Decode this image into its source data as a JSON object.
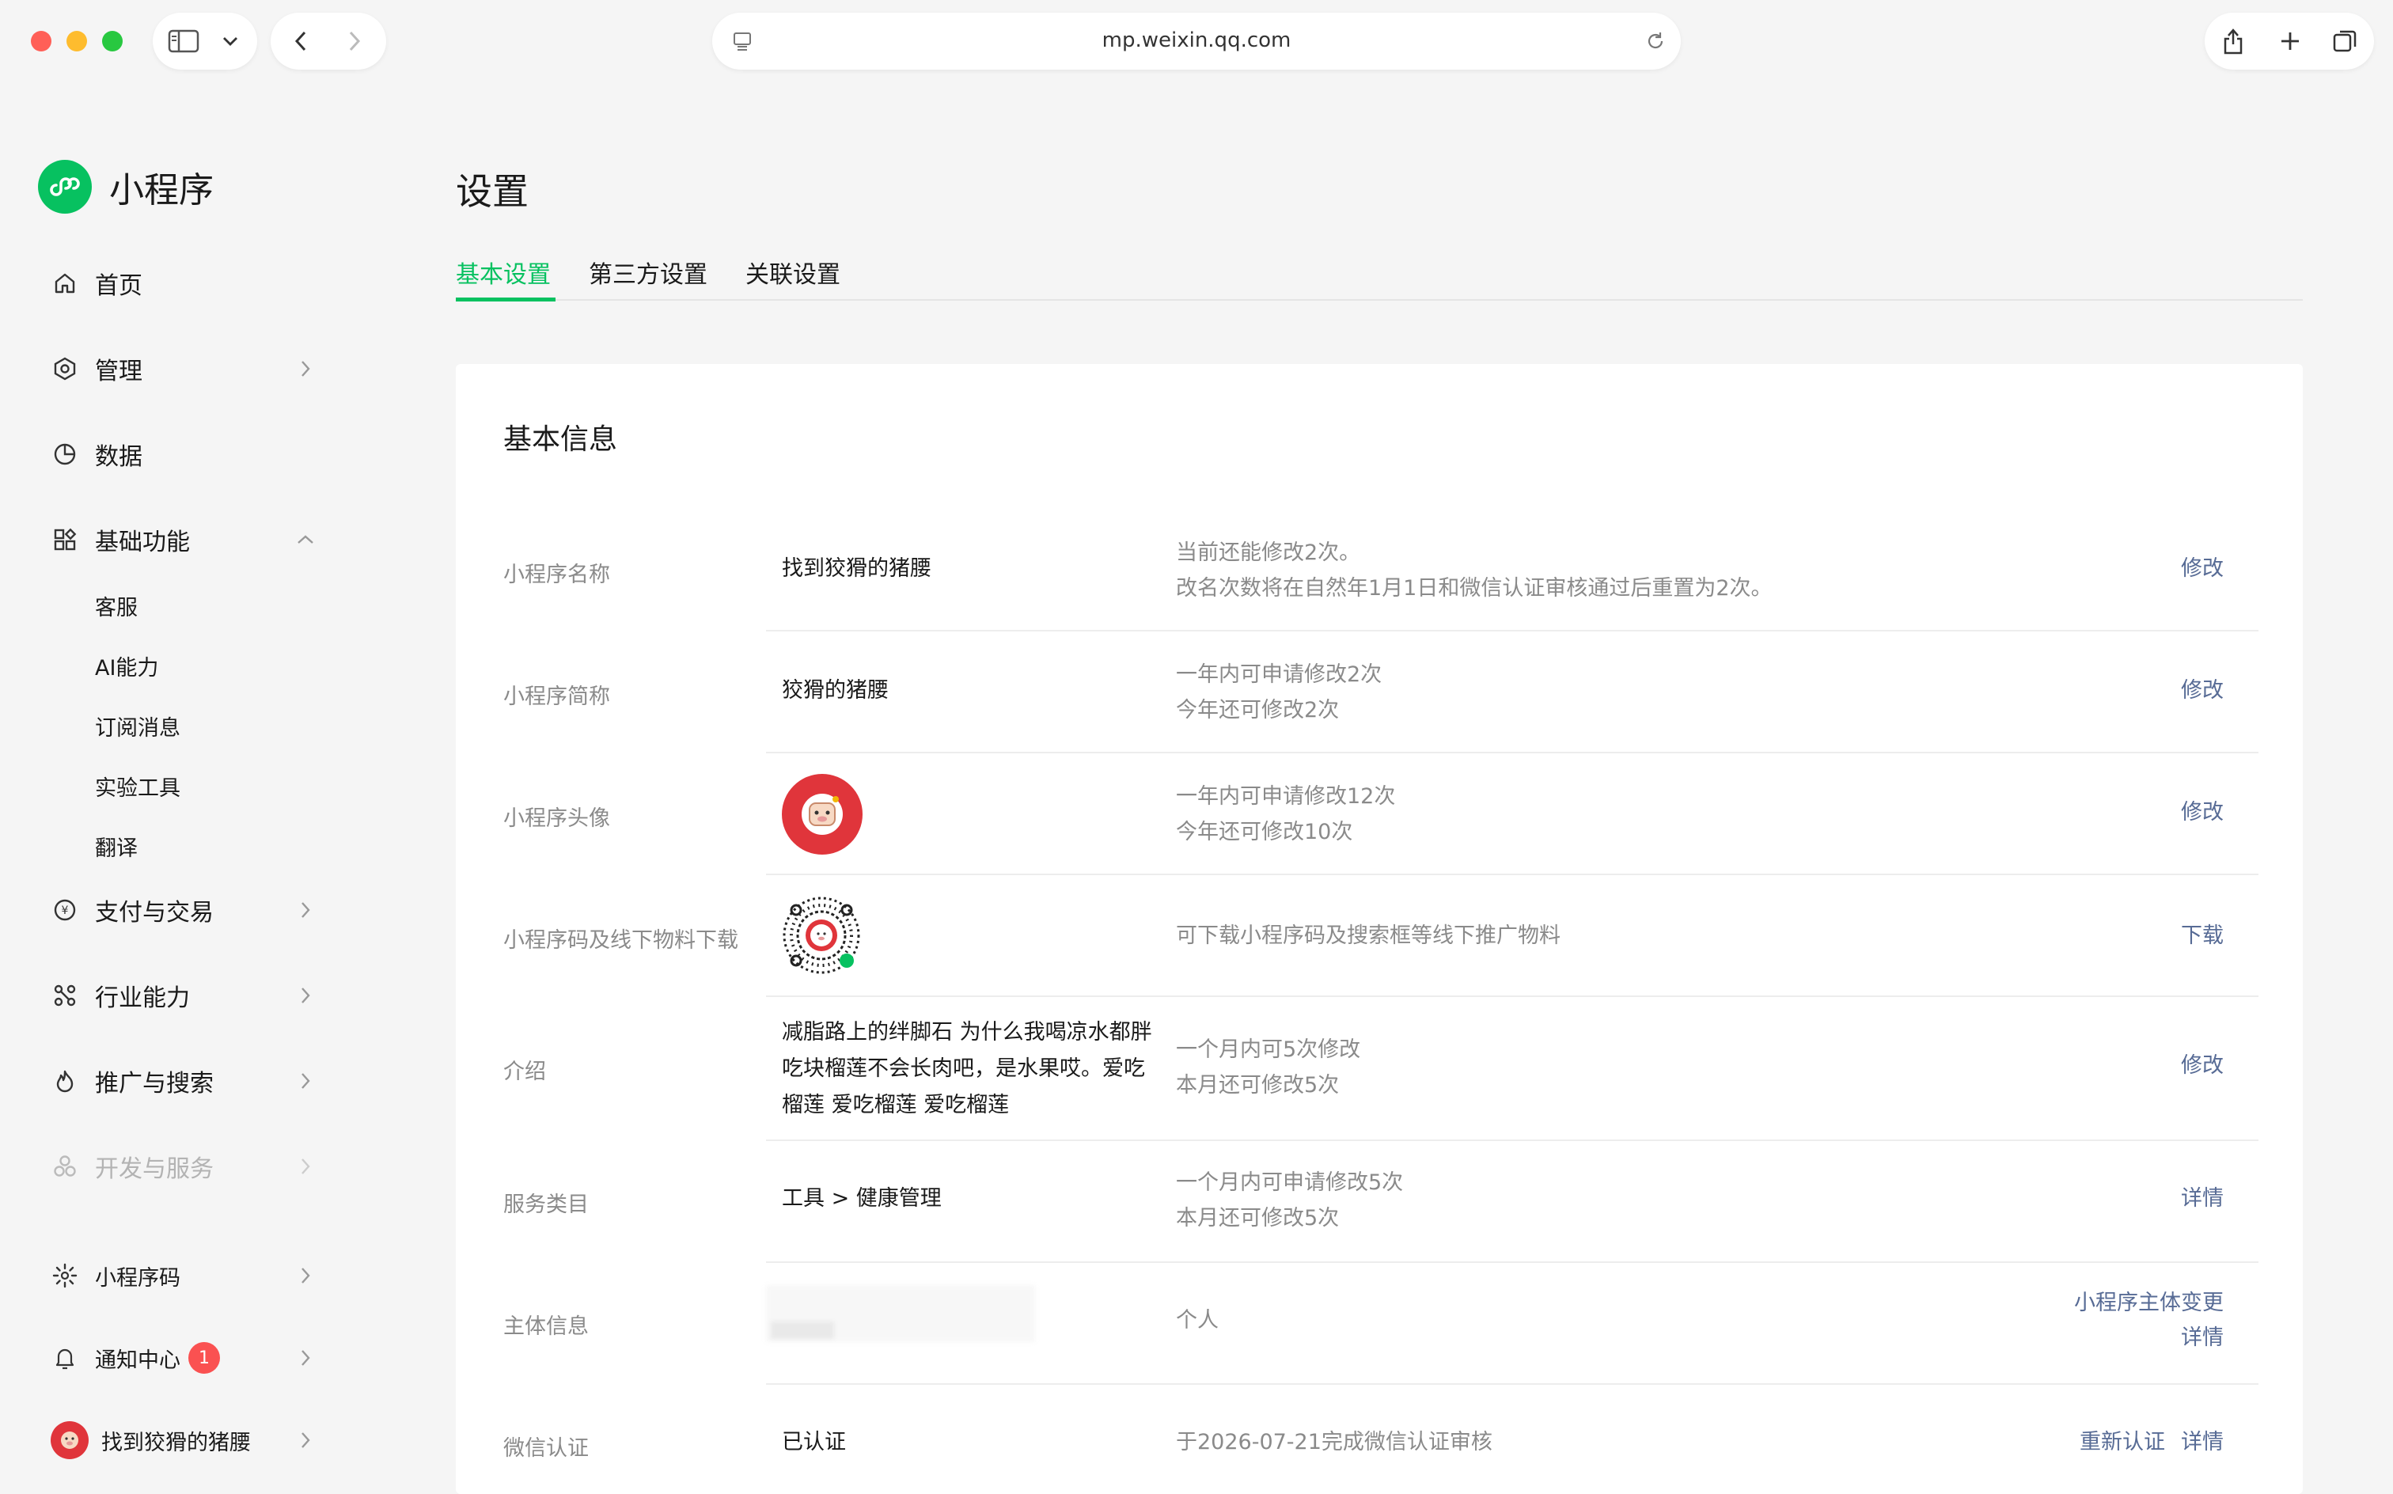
{
  "browser": {
    "url": "mp.weixin.qq.com",
    "traffic_lights": {
      "close": "#ff5f57",
      "minimize": "#febc2e",
      "zoom": "#28c840"
    }
  },
  "sidebar": {
    "brand": "小程序",
    "brand_color": "#07c160",
    "items": [
      {
        "label": "首页",
        "icon": "home-icon"
      },
      {
        "label": "管理",
        "icon": "hexagon-icon"
      },
      {
        "label": "数据",
        "icon": "pie-chart-icon"
      },
      {
        "label": "基础功能",
        "icon": "grid-icon"
      },
      {
        "label": "支付与交易",
        "icon": "yen-icon"
      },
      {
        "label": "行业能力",
        "icon": "nodes-icon"
      },
      {
        "label": "推广与搜索",
        "icon": "flame-icon"
      },
      {
        "label": "开发与服务",
        "icon": "circles-icon"
      }
    ],
    "sub_items": [
      "客服",
      "AI能力",
      "订阅消息",
      "实验工具",
      "翻译"
    ],
    "bottom": {
      "qrcode": "小程序码",
      "notifications": "通知中心",
      "notification_count": "1",
      "account": "找到狡猾的猪腰"
    }
  },
  "main": {
    "title": "设置",
    "tabs": [
      "基本设置",
      "第三方设置",
      "关联设置"
    ],
    "active_tab": 0,
    "section_title": "基本信息",
    "rows": [
      {
        "label": "小程序名称",
        "value": "找到狡猾的猪腰",
        "desc": [
          "当前还能修改2次。",
          "改名次数将在自然年1月1日和微信认证审核通过后重置为2次。"
        ],
        "actions": [
          "修改"
        ]
      },
      {
        "label": "小程序简称",
        "value": "狡猾的猪腰",
        "desc": [
          "一年内可申请修改2次",
          "今年还可修改2次"
        ],
        "actions": [
          "修改"
        ]
      },
      {
        "label": "小程序头像",
        "value": "",
        "desc": [
          "一年内可申请修改12次",
          "今年还可修改10次"
        ],
        "actions": [
          "修改"
        ]
      },
      {
        "label": "小程序码及线下物料下载",
        "value": "",
        "desc": [
          "可下载小程序码及搜索框等线下推广物料"
        ],
        "actions": [
          "下载"
        ]
      },
      {
        "label": "介绍",
        "value": "减脂路上的绊脚石 为什么我喝凉水都胖 吃块榴莲不会长肉吧，是水果哎。爱吃榴莲 爱吃榴莲 爱吃榴莲",
        "desc": [
          "一个月内可5次修改",
          "本月还可修改5次"
        ],
        "actions": [
          "修改"
        ]
      },
      {
        "label": "服务类目",
        "value": "工具 > 健康管理",
        "desc": [
          "一个月内可申请修改5次",
          "本月还可修改5次"
        ],
        "actions": [
          "详情"
        ]
      },
      {
        "label": "主体信息",
        "value": "",
        "desc": [
          "个人"
        ],
        "actions": [
          "小程序主体变更",
          "详情"
        ]
      },
      {
        "label": "微信认证",
        "value": "已认证",
        "desc": [
          "于2026-07-21完成微信认证审核"
        ],
        "actions": [
          "重新认证",
          "详情"
        ]
      }
    ]
  },
  "colors": {
    "accent": "#07c160",
    "link": "#576b95",
    "badge": "#fa5151",
    "avatar_red": "#e0353b"
  }
}
